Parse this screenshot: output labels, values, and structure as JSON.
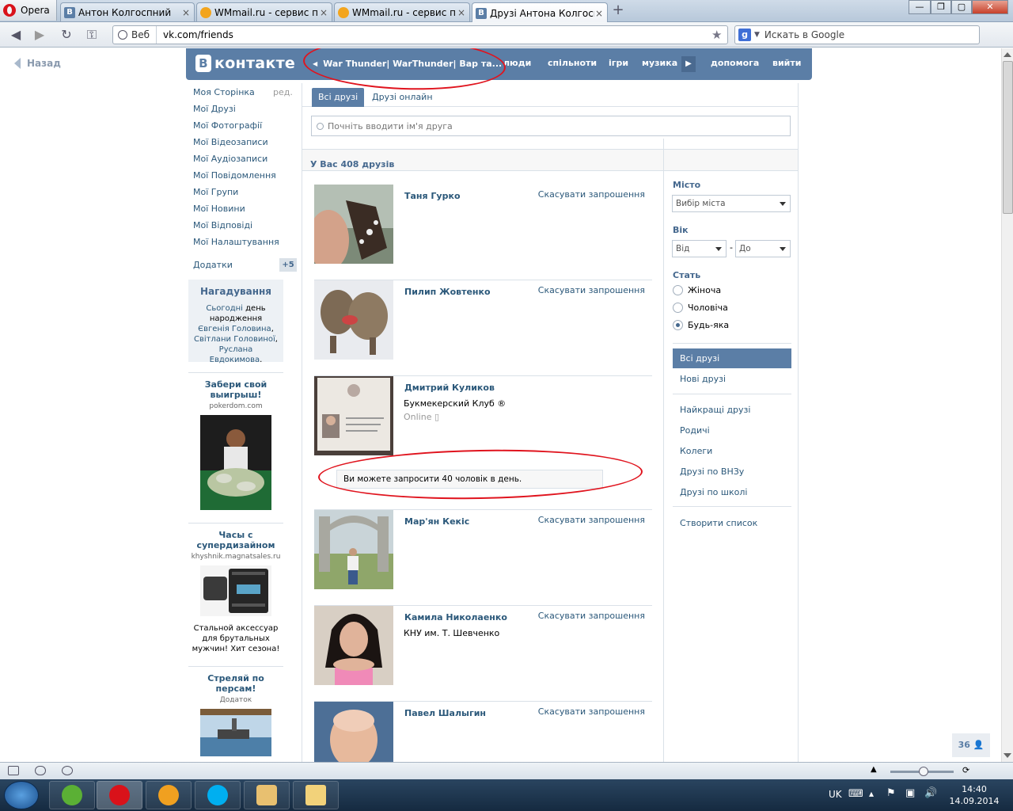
{
  "browser": {
    "menu_label": "Opera",
    "tabs": [
      {
        "title": "Антон Колгоспний",
        "icon": "vk-icon"
      },
      {
        "title": "WMmail.ru - сервис п...",
        "icon": "wmmail-icon"
      },
      {
        "title": "WMmail.ru - сервис п...",
        "icon": "wmmail-icon"
      },
      {
        "title": "Друзі Антона Колгосп...",
        "icon": "vk-icon",
        "active": true
      }
    ],
    "address": {
      "web_label": "Веб",
      "url": "vk.com/friends"
    },
    "search": {
      "placeholder": "Искать в Google"
    }
  },
  "page": {
    "back_label": "Назад",
    "header": {
      "logo_text": "контакте",
      "logo_letter": "В",
      "game_title": "War Thunder| WarThunder| Вар та...",
      "nav": [
        "люди",
        "спільноти",
        "ігри",
        "музика",
        "допомога",
        "вийти"
      ]
    },
    "left_menu": {
      "items": [
        "Моя Сторінка",
        "Мої Друзі",
        "Мої Фотографії",
        "Мої Відеозаписи",
        "Мої Аудіозаписи",
        "Мої Повідомлення",
        "Мої Групи",
        "Мої Новини",
        "Мої Відповіді",
        "Мої Налаштування"
      ],
      "edit_label": "ред.",
      "apps_label": "Додатки",
      "apps_count": "+5"
    },
    "reminder": {
      "title": "Нагадування",
      "link_today": "Сьогодні",
      "text_1": " день народження ",
      "person_1": "Євгенія Головина",
      "sep": ", ",
      "person_2": "Світлани Головиної",
      "person_3": "Руслана Евдокимова",
      "end": "."
    },
    "ads": [
      {
        "title": "Забери свой выигрыш!",
        "domain": "pokerdom.com"
      },
      {
        "title": "Часы с супердизайном",
        "domain": "khyshnik.magnatsales.ru",
        "desc": "Стальной аксессуар для брутальных мужчин! Хит сезона!"
      },
      {
        "title": "Стреляй по персам!",
        "domain": "Додаток"
      }
    ],
    "tabs": [
      "Всі друзі",
      "Друзі онлайн"
    ],
    "search_placeholder": "Почніть вводити ім'я друга",
    "count_text": "У Вас 408 друзів",
    "friends": [
      {
        "name": "Таня Гурко",
        "action": "Скасувати запрошення"
      },
      {
        "name": "Пилип Жовтенко",
        "action": "Скасувати запрошення"
      },
      {
        "name": "Дмитрий Куликов",
        "sub": "Букмекерский Клуб ®",
        "status": "Online"
      },
      {
        "name": "Мар'ян Кекіс",
        "action": "Скасувати запрошення"
      },
      {
        "name": "Камила Николаенко",
        "sub": "КНУ им. Т. Шевченко",
        "action": "Скасувати запрошення"
      },
      {
        "name": "Павел Шалыгин",
        "action": "Скасувати запрошення"
      }
    ],
    "invite_note": "Ви можете запросити 40 чоловік в день.",
    "filters": {
      "city_label": "Місто",
      "city_value": "Вибір міста",
      "age_label": "Вік",
      "age_from": "Від",
      "age_dash": "-",
      "age_to": "До",
      "sex_label": "Стать",
      "sex_options": [
        "Жіноча",
        "Чоловіча",
        "Будь-яка"
      ],
      "sex_selected": "Будь-яка",
      "lists": [
        "Всі друзі",
        "Нові друзі"
      ],
      "groups": [
        "Найкращі друзі",
        "Родичі",
        "Колеги",
        "Друзі по ВНЗу",
        "Друзі по школі"
      ],
      "create_list": "Створити список"
    },
    "counter_value": "36"
  },
  "taskbar": {
    "lang": "UK",
    "time": "14:40",
    "date": "14.09.2014"
  },
  "colors": {
    "vk_blue": "#5b7ea6",
    "link": "#2b587a",
    "annotation": "#e0141e"
  }
}
